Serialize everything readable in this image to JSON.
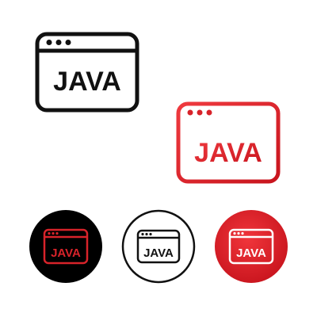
{
  "icons": [
    {
      "label": "JAVA",
      "style": "outline",
      "stroke_color": "#111111",
      "text_color": "#111111",
      "background": "none",
      "dots": 3
    },
    {
      "label": "JAVA",
      "style": "outline-gradient",
      "stroke_color": "#d8232a",
      "text_color": "#d8232a",
      "background": "none",
      "dots": 3
    },
    {
      "label": "JAVA",
      "style": "solid-circle",
      "stroke_color": "#d8232a",
      "text_color": "#d8232a",
      "background": "#000000",
      "dots": 3
    },
    {
      "label": "JAVA",
      "style": "outline-circle",
      "stroke_color": "#111111",
      "text_color": "#111111",
      "background": "#ffffff",
      "dots": 3
    },
    {
      "label": "JAVA",
      "style": "gradient-circle",
      "stroke_color": "#ffffff",
      "text_color": "#ffffff",
      "background": "#e0232b",
      "dots": 3
    }
  ]
}
